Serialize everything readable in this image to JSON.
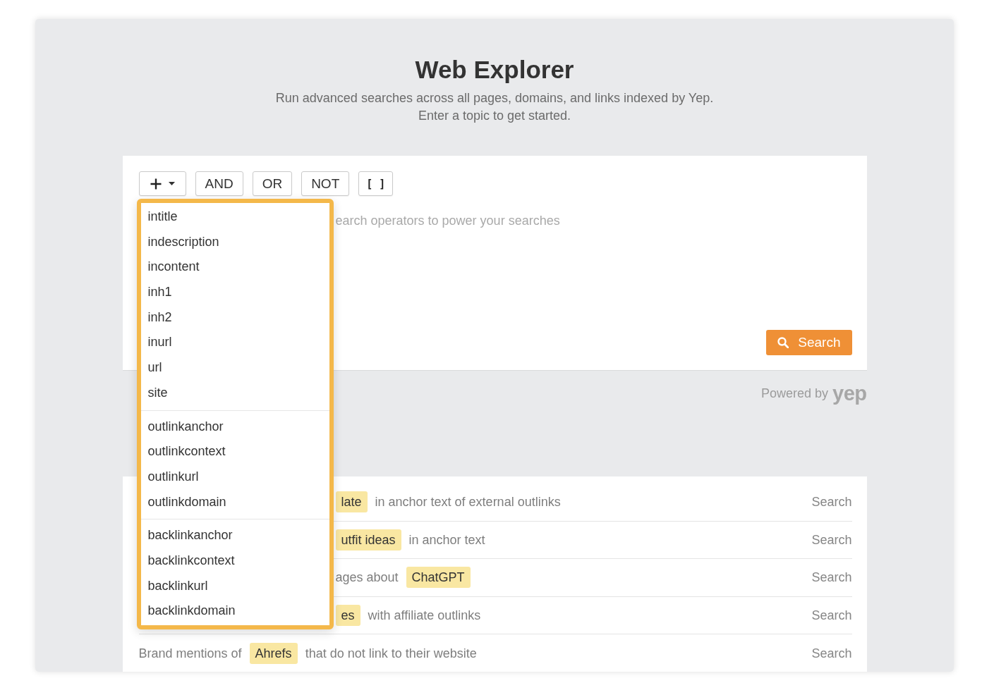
{
  "header": {
    "title": "Web Explorer",
    "subtitle_lines": [
      "Run advanced searches across all pages, domains, and links indexed by Yep.",
      "Enter a topic to get started."
    ]
  },
  "query_editor": {
    "toolbar": [
      {
        "kind": "add_menu",
        "expanded": true
      },
      {
        "kind": "text",
        "label": "AND"
      },
      {
        "kind": "text",
        "label": "OR"
      },
      {
        "kind": "text",
        "label": "NOT"
      },
      {
        "kind": "brackets",
        "label": "[ ]"
      }
    ],
    "operator_menu": {
      "groups": [
        {
          "items": [
            "intitle",
            "indescription",
            "incontent",
            "inh1",
            "inh2",
            "inurl",
            "url",
            "site"
          ]
        },
        {
          "items": [
            "outlinkanchor",
            "outlinkcontext",
            "outlinkurl",
            "outlinkdomain"
          ]
        },
        {
          "items": [
            "backlinkanchor",
            "backlinkcontext",
            "backlinkurl",
            "backlinkdomain"
          ]
        }
      ]
    },
    "query": {
      "placeholder": "earch operators to power your searches"
    },
    "search_button": {
      "label": "Search"
    }
  },
  "powered_by": {
    "label": "Powered by",
    "logo": "yep"
  },
  "examples": [
    {
      "parts": [
        {
          "kind": "highlight",
          "text": "late"
        },
        {
          "kind": "plain",
          "text": "in anchor text of external outlinks"
        }
      ],
      "action": "Search"
    },
    {
      "parts": [
        {
          "kind": "highlight",
          "text": "utfit ideas"
        },
        {
          "kind": "plain",
          "text": "in anchor text"
        }
      ],
      "action": "Search"
    },
    {
      "parts": [
        {
          "kind": "plain",
          "text": "ages about"
        },
        {
          "kind": "highlight",
          "text": "ChatGPT"
        }
      ],
      "action": "Search"
    },
    {
      "parts": [
        {
          "kind": "highlight",
          "text": "es"
        },
        {
          "kind": "plain",
          "text": "with affiliate outlinks"
        }
      ],
      "action": "Search"
    },
    {
      "parts": [
        {
          "kind": "plain",
          "text": "Brand mentions of"
        },
        {
          "kind": "highlight",
          "text": "Ahrefs"
        },
        {
          "kind": "plain",
          "text": "that do not link to their website"
        }
      ],
      "action": "Search"
    }
  ]
}
